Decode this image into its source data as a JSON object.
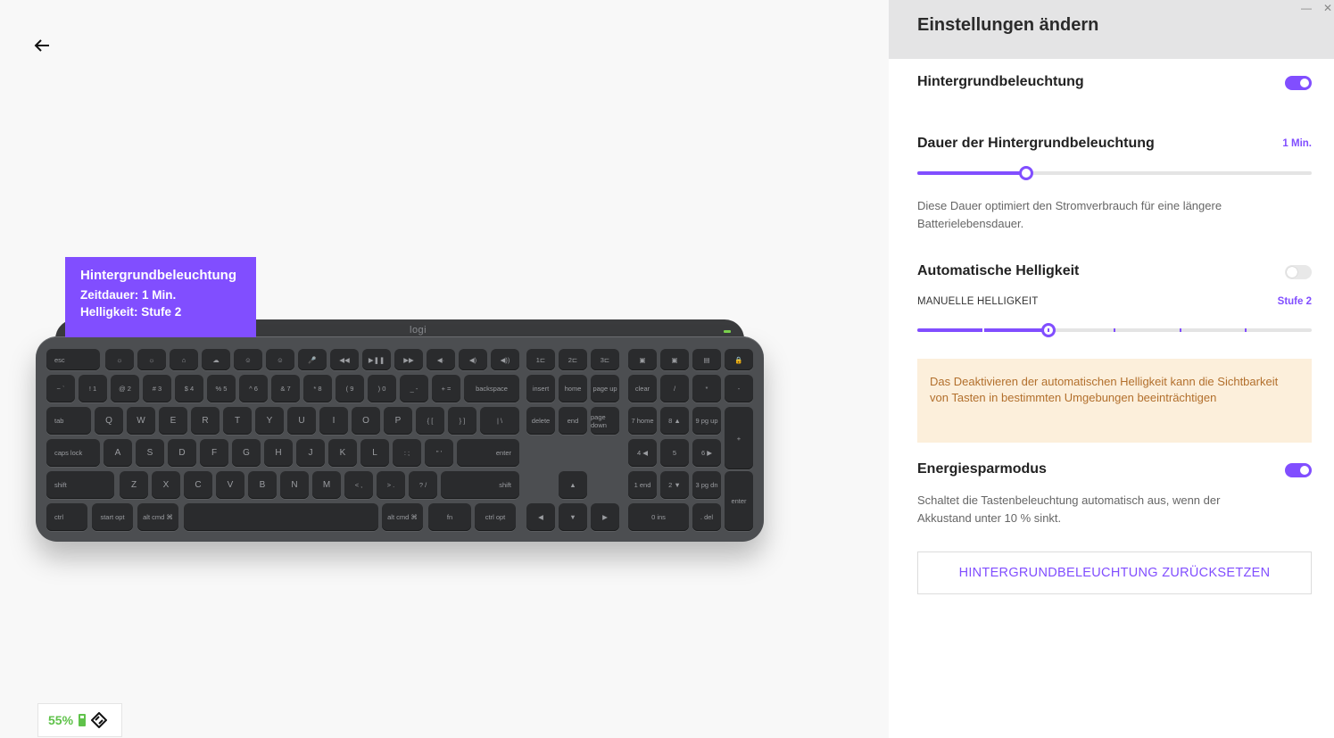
{
  "tooltip": {
    "title": "Hintergrundbeleuchtung",
    "duration": "Zeitdauer: 1 Min.",
    "brightness": "Helligkeit: Stufe 2"
  },
  "keyboard": {
    "logo": "logi",
    "rows": [
      [
        [
          "esc",
          "l"
        ],
        [
          "☼",
          ""
        ],
        [
          "☼",
          ""
        ],
        [
          "⌂",
          ""
        ],
        [
          "☁",
          ""
        ],
        [
          "☺",
          ""
        ],
        [
          "☺",
          ""
        ],
        [
          "🎤",
          ""
        ],
        [
          "◀◀",
          ""
        ],
        [
          "▶❚❚",
          ""
        ],
        [
          "▶▶",
          ""
        ],
        [
          "◀·",
          ""
        ],
        [
          "◀)",
          ""
        ],
        [
          "◀))",
          ""
        ],
        [
          "1⊏",
          ""
        ],
        [
          "2⊏",
          ""
        ],
        [
          "3⊏",
          ""
        ],
        [
          "▣",
          ""
        ],
        [
          "▣",
          ""
        ],
        [
          "▤",
          ""
        ],
        [
          "🔒",
          ""
        ]
      ],
      [
        [
          "~ `",
          ""
        ],
        [
          "! 1",
          ""
        ],
        [
          "@ 2",
          ""
        ],
        [
          "# 3",
          ""
        ],
        [
          "$ 4",
          ""
        ],
        [
          "% 5",
          ""
        ],
        [
          "^ 6",
          ""
        ],
        [
          "& 7",
          ""
        ],
        [
          "* 8",
          ""
        ],
        [
          "( 9",
          ""
        ],
        [
          ") 0",
          ""
        ],
        [
          "_ -",
          ""
        ],
        [
          "+ =",
          ""
        ],
        [
          "backspace",
          ""
        ],
        [
          "insert",
          ""
        ],
        [
          "home",
          ""
        ],
        [
          "page up",
          ""
        ],
        [
          "clear",
          ""
        ],
        [
          "/",
          ""
        ],
        [
          "*",
          ""
        ],
        [
          "-",
          ""
        ]
      ],
      [
        [
          "tab",
          "l"
        ],
        [
          "Q",
          ""
        ],
        [
          "W",
          ""
        ],
        [
          "E",
          ""
        ],
        [
          "R",
          ""
        ],
        [
          "T",
          ""
        ],
        [
          "Y",
          ""
        ],
        [
          "U",
          ""
        ],
        [
          "I",
          ""
        ],
        [
          "O",
          ""
        ],
        [
          "P",
          ""
        ],
        [
          "{ [",
          ""
        ],
        [
          "} ]",
          ""
        ],
        [
          "| \\",
          ""
        ],
        [
          "delete",
          ""
        ],
        [
          "end",
          ""
        ],
        [
          "page down",
          ""
        ],
        [
          "7 home",
          ""
        ],
        [
          "8 ▲",
          ""
        ],
        [
          "9 pg up",
          ""
        ],
        [
          "+",
          ""
        ]
      ],
      [
        [
          "caps lock",
          "l"
        ],
        [
          "A",
          ""
        ],
        [
          "S",
          ""
        ],
        [
          "D",
          ""
        ],
        [
          "F",
          ""
        ],
        [
          "G",
          ""
        ],
        [
          "H",
          ""
        ],
        [
          "J",
          ""
        ],
        [
          "K",
          ""
        ],
        [
          "L",
          ""
        ],
        [
          ": ;",
          ""
        ],
        [
          "\" '",
          ""
        ],
        [
          "enter",
          "r"
        ],
        [
          "4 ◀",
          ""
        ],
        [
          "5",
          ""
        ],
        [
          "6 ▶",
          ""
        ]
      ],
      [
        [
          "shift",
          "l"
        ],
        [
          "Z",
          ""
        ],
        [
          "X",
          ""
        ],
        [
          "C",
          ""
        ],
        [
          "V",
          ""
        ],
        [
          "B",
          ""
        ],
        [
          "N",
          ""
        ],
        [
          "M",
          ""
        ],
        [
          "< ,",
          ""
        ],
        [
          "> .",
          ""
        ],
        [
          "? /",
          ""
        ],
        [
          "shift",
          "r"
        ],
        [
          "▲",
          ""
        ],
        [
          "1 end",
          ""
        ],
        [
          "2 ▼",
          ""
        ],
        [
          "3 pg dn",
          ""
        ],
        [
          "enter",
          ""
        ]
      ],
      [
        [
          "ctrl",
          "l"
        ],
        [
          "start opt",
          ""
        ],
        [
          "alt cmd ⌘",
          ""
        ],
        [
          "",
          ""
        ],
        [
          "alt cmd ⌘",
          ""
        ],
        [
          "fn",
          ""
        ],
        [
          "ctrl opt",
          ""
        ],
        [
          "◀",
          ""
        ],
        [
          "▼",
          ""
        ],
        [
          "▶",
          ""
        ],
        [
          "0 ins",
          ""
        ],
        [
          ". del",
          ""
        ]
      ]
    ]
  },
  "battery": {
    "percent": "55%"
  },
  "panel": {
    "title": "Einstellungen ändern",
    "backlight": {
      "label": "Hintergrundbeleuchtung",
      "enabled": true
    },
    "duration": {
      "label": "Dauer der Hintergrundbeleuchtung",
      "value": "1 Min.",
      "level": 0.275,
      "description": "Diese Dauer optimiert den Stromverbrauch für eine längere Batterielebensdauer."
    },
    "auto_brightness": {
      "label": "Automatische Helligkeit",
      "enabled": false
    },
    "manual_brightness": {
      "label": "MANUELLE HELLIGKEIT",
      "value": "Stufe 2",
      "level": 2,
      "steps": 7
    },
    "warning": "Das Deaktivieren der automatischen Helligkeit kann die Sichtbarkeit von Tasten in bestimmten Umgebungen beeinträchtigen",
    "power_saving": {
      "label": "Energiesparmodus",
      "enabled": true,
      "description": "Schaltet die Tastenbeleuchtung automatisch aus, wenn der Akkustand unter 10 % sinkt."
    },
    "reset_button": "HINTERGRUNDBELEUCHTUNG ZURÜCKSETZEN"
  },
  "colors": {
    "accent": "#814eff",
    "battery_green": "#5fc24a",
    "warning_bg": "#fcefdb",
    "warning_text": "#b26f2c"
  },
  "icons": [
    "back-arrow-icon",
    "battery-icon",
    "connection-icon",
    "minimize-icon",
    "close-icon"
  ]
}
